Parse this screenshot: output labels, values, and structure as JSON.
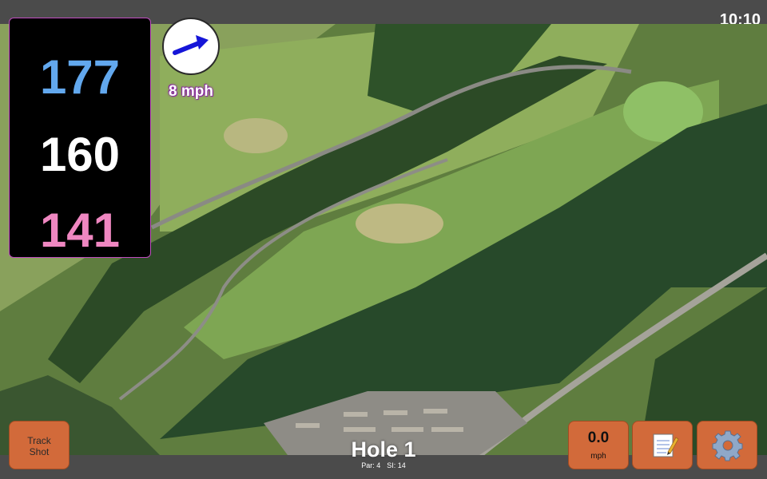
{
  "status": {
    "time": "10:10"
  },
  "yardages": {
    "back": "177",
    "middle": "160",
    "front": "141"
  },
  "wind": {
    "speed_label": "8 mph",
    "direction_icon": "arrow-icon"
  },
  "hole": {
    "title": "Hole 1",
    "par_label": "Par: 4",
    "si_label": "SI: 14"
  },
  "buttons": {
    "track_shot_line1": "Track",
    "track_shot_line2": "Shot",
    "speed_value": "0.0",
    "speed_unit": "mph",
    "notes_icon": "notepad-icon",
    "settings_icon": "gear-icon"
  },
  "colors": {
    "back_yardage": "#62a8ee",
    "middle_yardage": "#ffffff",
    "front_yardage": "#ef87c1",
    "button": "#d26a3a",
    "accent_border": "#c04cc0"
  }
}
